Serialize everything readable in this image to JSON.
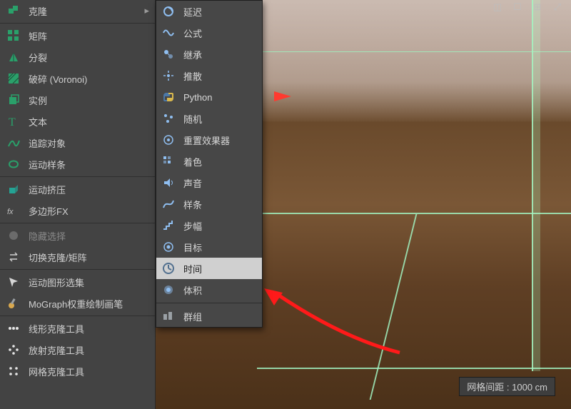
{
  "viewport": {
    "status": "网格间距 : 1000 cm",
    "axis_arrow": "x-axis"
  },
  "left_menu": {
    "items": [
      {
        "id": "clone",
        "label": "克隆",
        "icon": "clone-icon"
      },
      {
        "id": "matrix",
        "label": "矩阵",
        "icon": "matrix-icon"
      },
      {
        "id": "split",
        "label": "分裂",
        "icon": "split-icon"
      },
      {
        "id": "voronoi",
        "label": "破碎 (Voronoi)",
        "icon": "voronoi-icon"
      },
      {
        "id": "instance",
        "label": "实例",
        "icon": "instance-icon"
      },
      {
        "id": "text",
        "label": "文本",
        "icon": "text-icon"
      },
      {
        "id": "tracer",
        "label": "追踪对象",
        "icon": "tracer-icon"
      },
      {
        "id": "mospline",
        "label": "运动样条",
        "icon": "mospline-icon"
      },
      {
        "id": "moextrude",
        "label": "运动挤压",
        "icon": "moextrude-icon"
      },
      {
        "id": "polyfx",
        "label": "多边形FX",
        "icon": "polyfx-icon"
      },
      {
        "id": "hidesel",
        "label": "隐藏选择",
        "icon": "hidesel-icon",
        "disabled": true
      },
      {
        "id": "swapclone",
        "label": "切换克隆/矩阵",
        "icon": "swap-icon"
      },
      {
        "id": "moselection",
        "label": "运动图形选集",
        "icon": "mosel-icon"
      },
      {
        "id": "moweight",
        "label": "MoGraph权重绘制画笔",
        "icon": "moweight-icon"
      },
      {
        "id": "linearclone",
        "label": "线形克隆工具",
        "icon": "linearclone-icon"
      },
      {
        "id": "radialclone",
        "label": "放射克隆工具",
        "icon": "radialclone-icon"
      },
      {
        "id": "gridclone",
        "label": "网格克隆工具",
        "icon": "gridclone-icon"
      }
    ],
    "separators_after": [
      "clone",
      "mospline",
      "polyfx",
      "swapclone",
      "moweight"
    ]
  },
  "submenu": {
    "items": [
      {
        "id": "delay",
        "label": "延迟",
        "icon": "delay-icon"
      },
      {
        "id": "formula",
        "label": "公式",
        "icon": "formula-icon"
      },
      {
        "id": "inherit",
        "label": "继承",
        "icon": "inherit-icon"
      },
      {
        "id": "push",
        "label": "推散",
        "icon": "push-icon"
      },
      {
        "id": "python",
        "label": "Python",
        "icon": "python-icon"
      },
      {
        "id": "random",
        "label": "随机",
        "icon": "random-icon"
      },
      {
        "id": "reeffector",
        "label": "重置效果器",
        "icon": "reeffector-icon"
      },
      {
        "id": "shader",
        "label": "着色",
        "icon": "shader-icon"
      },
      {
        "id": "sound",
        "label": "声音",
        "icon": "sound-icon"
      },
      {
        "id": "spline",
        "label": "样条",
        "icon": "spline-icon"
      },
      {
        "id": "step",
        "label": "步幅",
        "icon": "step-icon"
      },
      {
        "id": "target",
        "label": "目标",
        "icon": "target-icon"
      },
      {
        "id": "time",
        "label": "时间",
        "icon": "time-icon",
        "selected": true
      },
      {
        "id": "volume",
        "label": "体积",
        "icon": "volume-icon"
      },
      {
        "id": "group",
        "label": "群组",
        "icon": "group-icon"
      }
    ],
    "separator_before": "group"
  },
  "annotation": {
    "arrow_target": "submenu.time"
  }
}
